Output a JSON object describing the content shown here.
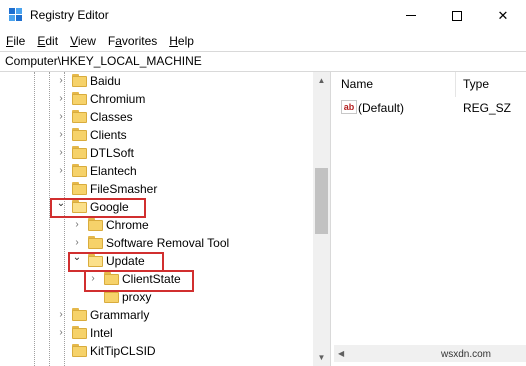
{
  "window": {
    "title": "Registry Editor",
    "minimize_label": "",
    "maximize_label": "",
    "close_label": "✕"
  },
  "menu": {
    "items": [
      {
        "label": "File",
        "underline": "F"
      },
      {
        "label": "Edit",
        "underline": "E"
      },
      {
        "label": "View",
        "underline": "V"
      },
      {
        "label": "Favorites",
        "underline": "a"
      },
      {
        "label": "Help",
        "underline": "H"
      }
    ]
  },
  "address": {
    "path": "Computer\\HKEY_LOCAL_MACHINE"
  },
  "tree": {
    "items": [
      {
        "label": "Baidu",
        "expander": "›",
        "highlighted": false
      },
      {
        "label": "Chromium",
        "expander": "›",
        "highlighted": false
      },
      {
        "label": "Classes",
        "expander": "›",
        "highlighted": false
      },
      {
        "label": "Clients",
        "expander": "›",
        "highlighted": false
      },
      {
        "label": "DTLSoft",
        "expander": "›",
        "highlighted": false
      },
      {
        "label": "Elantech",
        "expander": "›",
        "highlighted": false
      },
      {
        "label": "FileSmasher",
        "expander": "",
        "highlighted": false
      },
      {
        "label": "Google",
        "expander": "⌄",
        "highlighted": true
      },
      {
        "label": "Chrome",
        "expander": "›",
        "highlighted": false
      },
      {
        "label": "Software Removal Tool",
        "expander": "›",
        "highlighted": false
      },
      {
        "label": "Update",
        "expander": "⌄",
        "highlighted": true
      },
      {
        "label": "ClientState",
        "expander": "›",
        "highlighted": true
      },
      {
        "label": "proxy",
        "expander": "",
        "highlighted": false
      },
      {
        "label": "Grammarly",
        "expander": "›",
        "highlighted": false
      },
      {
        "label": "Intel",
        "expander": "›",
        "highlighted": false
      },
      {
        "label": "KitTipCLSID",
        "expander": "",
        "highlighted": false
      }
    ]
  },
  "values_pane": {
    "columns": {
      "name": "Name",
      "type": "Type"
    },
    "rows": [
      {
        "icon": "ab",
        "name": "(Default)",
        "type": "REG_SZ"
      }
    ]
  },
  "watermark": "wsxdn.com",
  "colors": {
    "highlight_border": "#d12f2f",
    "folder": "#f6d26a",
    "scroll_track": "#f0f0f0",
    "scroll_thumb": "#c2c2c2"
  },
  "icons": {
    "app": "registry-editor-icon",
    "folder": "folder-icon",
    "value": "string-value-icon"
  }
}
